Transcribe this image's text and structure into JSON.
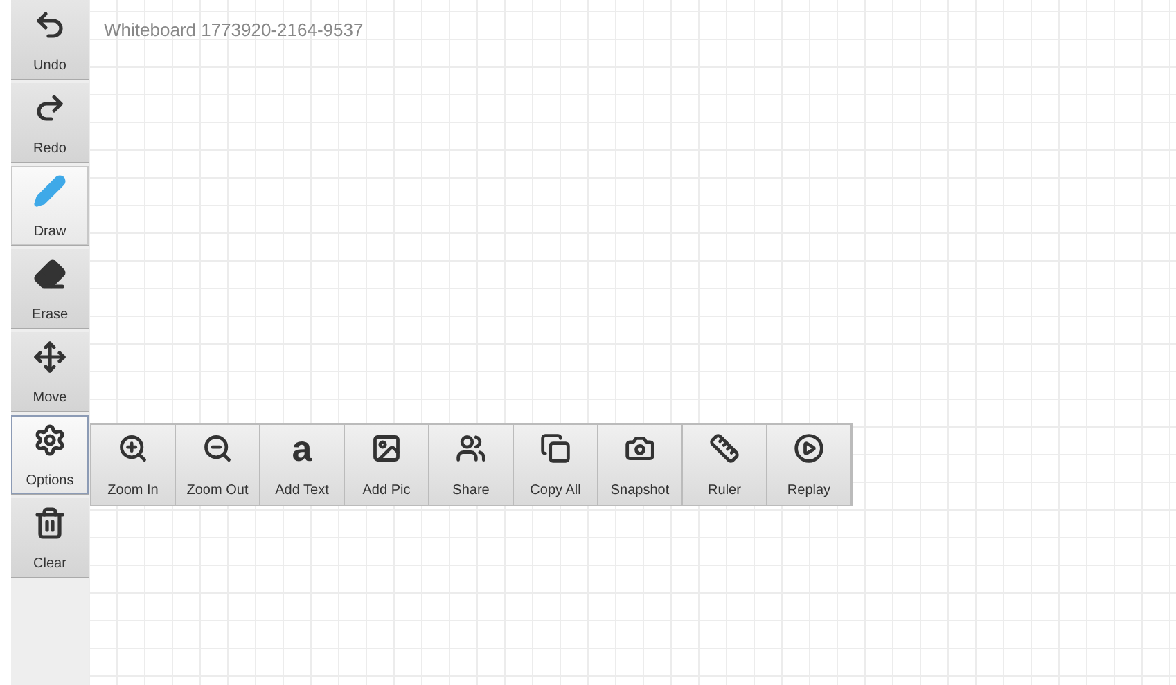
{
  "title": "Whiteboard 1773920-2164-9537",
  "sidebar": [
    {
      "label": "Undo",
      "selected": false
    },
    {
      "label": "Redo",
      "selected": false
    },
    {
      "label": "Draw",
      "selected": true
    },
    {
      "label": "Erase",
      "selected": false
    },
    {
      "label": "Move",
      "selected": false
    },
    {
      "label": "Options",
      "selected": true
    },
    {
      "label": "Clear",
      "selected": false
    }
  ],
  "options_menu": [
    {
      "label": "Zoom In"
    },
    {
      "label": "Zoom Out"
    },
    {
      "label": "Add Text",
      "glyph": "a"
    },
    {
      "label": "Add Pic"
    },
    {
      "label": "Share"
    },
    {
      "label": "Copy All"
    },
    {
      "label": "Snapshot"
    },
    {
      "label": "Ruler"
    },
    {
      "label": "Replay"
    }
  ]
}
